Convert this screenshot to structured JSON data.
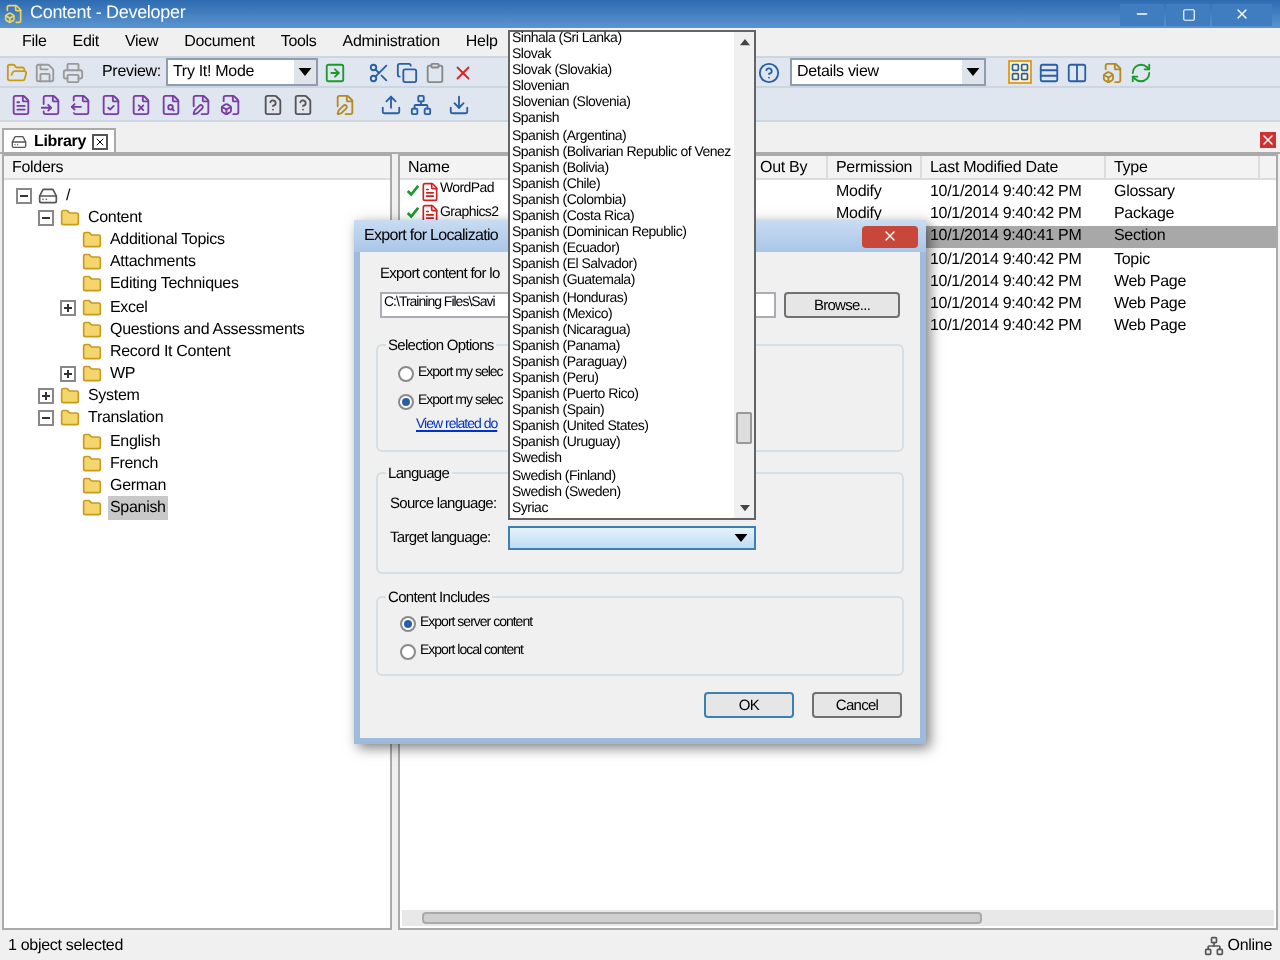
{
  "window": {
    "title": "Content - Developer"
  },
  "menu": [
    "File",
    "Edit",
    "View",
    "Document",
    "Tools",
    "Administration",
    "Help"
  ],
  "toolbar": {
    "preview_label": "Preview:",
    "preview_mode": "Try It! Mode",
    "view_mode": "Details view"
  },
  "tabs": [
    {
      "label": "Library",
      "selected": true
    }
  ],
  "folders": {
    "header": "Folders",
    "tree": [
      {
        "name": "/",
        "kind": "drive",
        "expanded": true,
        "selected": false,
        "children": [
          {
            "name": "Content",
            "kind": "folder",
            "expanded": true,
            "selected": false,
            "children": [
              {
                "name": "Additional Topics",
                "kind": "folder",
                "selected": false
              },
              {
                "name": "Attachments",
                "kind": "folder",
                "selected": false
              },
              {
                "name": "Editing Techniques",
                "kind": "folder",
                "selected": false
              },
              {
                "name": "Excel",
                "kind": "folder",
                "expanded": false,
                "selected": false
              },
              {
                "name": "Questions and Assessments",
                "kind": "folder",
                "selected": false
              },
              {
                "name": "Record It Content",
                "kind": "folder",
                "selected": false
              },
              {
                "name": "WP",
                "kind": "folder",
                "expanded": false,
                "selected": false
              }
            ]
          },
          {
            "name": "System",
            "kind": "folder",
            "expanded": false,
            "selected": false
          },
          {
            "name": "Translation",
            "kind": "folder",
            "expanded": true,
            "selected": false,
            "children": [
              {
                "name": "English",
                "kind": "folder",
                "selected": false
              },
              {
                "name": "French",
                "kind": "folder",
                "selected": false
              },
              {
                "name": "German",
                "kind": "folder",
                "selected": false
              },
              {
                "name": "Spanish",
                "kind": "folder",
                "selected": true
              }
            ]
          }
        ]
      }
    ]
  },
  "table": {
    "columns": [
      "Name",
      "Out By",
      "Permission",
      "Last Modified Date",
      "Type"
    ],
    "rows": [
      {
        "name": "WordPad",
        "checked_in": true,
        "permission": "Modify",
        "modified": "10/1/2014 9:40:42 PM",
        "type": "Glossary",
        "selected": false
      },
      {
        "name": "Graphics2",
        "checked_in": true,
        "permission": "Modify",
        "modified": "10/1/2014 9:40:42 PM",
        "type": "Package",
        "selected": false
      },
      {
        "modified": "10/1/2014 9:40:41 PM",
        "type": "Section",
        "selected": true
      },
      {
        "modified": "10/1/2014 9:40:42 PM",
        "type": "Topic",
        "selected": false
      },
      {
        "modified": "10/1/2014 9:40:42 PM",
        "type": "Web Page",
        "selected": false
      },
      {
        "modified": "10/1/2014 9:40:42 PM",
        "type": "Web Page",
        "selected": false
      },
      {
        "modified": "10/1/2014 9:40:42 PM",
        "type": "Web Page",
        "selected": false
      }
    ]
  },
  "dialog": {
    "title": "Export for Localizatio",
    "export_label": "Export content for lo",
    "path": "C:\\Training Files\\Savi",
    "browse": "Browse...",
    "selection": {
      "title": "Selection Options",
      "options": [
        {
          "label": "Export my selec",
          "selected": false
        },
        {
          "label": "Export my selec",
          "selected": true
        }
      ],
      "link": "View related do"
    },
    "language": {
      "title": "Language",
      "source_label": "Source language:",
      "target_label": "Target language:"
    },
    "content": {
      "title": "Content Includes",
      "options": [
        {
          "label": "Export server content",
          "selected": true
        },
        {
          "label": "Export local content",
          "selected": false
        }
      ]
    },
    "buttons": [
      "OK",
      "Cancel"
    ]
  },
  "language_list": [
    "Sinhala (Sri Lanka)",
    "Slovak",
    "Slovak (Slovakia)",
    "Slovenian",
    "Slovenian (Slovenia)",
    "Spanish",
    "Spanish (Argentina)",
    "Spanish (Bolivarian Republic of Venez",
    "Spanish (Bolivia)",
    "Spanish (Chile)",
    "Spanish (Colombia)",
    "Spanish (Costa Rica)",
    "Spanish (Dominican Republic)",
    "Spanish (Ecuador)",
    "Spanish (El Salvador)",
    "Spanish (Guatemala)",
    "Spanish (Honduras)",
    "Spanish (Mexico)",
    "Spanish (Nicaragua)",
    "Spanish (Panama)",
    "Spanish (Paraguay)",
    "Spanish (Peru)",
    "Spanish (Puerto Rico)",
    "Spanish (Spain)",
    "Spanish (United States)",
    "Spanish (Uruguay)",
    "Swedish",
    "Swedish (Finland)",
    "Swedish (Sweden)",
    "Syriac"
  ],
  "status_bar": {
    "text": "1 object selected",
    "connection": "Online"
  }
}
